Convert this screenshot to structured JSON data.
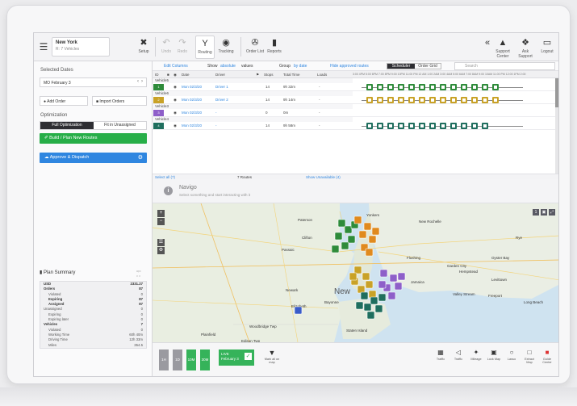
{
  "header": {
    "city": "New York",
    "city_sub": "R: 7 Vehicles",
    "setup_label": "Setup",
    "undo_label": "Undo",
    "redo_label": "Redo",
    "routing_label": "Routing",
    "tracking_label": "Tracking",
    "order_list_label": "Order List",
    "reports_label": "Reports",
    "support_center_label": "Support Center",
    "ask_support_label": "Ask Support",
    "logout_label": "Logout"
  },
  "left": {
    "selected_dates_label": "Selected Dates",
    "date_value": "MO February 3",
    "add_order": "Add Order",
    "import_orders": "Import Orders",
    "optimization_label": "Optimization",
    "tab_full": "Full Optimization",
    "tab_fit": "Fit in Unassigned",
    "build_btn": "Build / Plan New Routes",
    "approve_btn": "Approve & Dispatch",
    "plan_summary_title": "Plan Summary",
    "plan_summary_sub": "ᵃᵖᵒ ᵒ ᵒ",
    "summary_rows": [
      {
        "label": "USD",
        "value": "2331.27",
        "bold": true,
        "indent": false
      },
      {
        "label": "Orders",
        "value": "87",
        "bold": true,
        "indent": false
      },
      {
        "label": "Violated",
        "value": "0",
        "bold": false,
        "indent": true
      },
      {
        "label": "Expiring",
        "value": "87",
        "bold": true,
        "indent": true
      },
      {
        "label": "Assigned",
        "value": "87",
        "bold": true,
        "indent": true
      },
      {
        "label": "Unassigned",
        "value": "0",
        "bold": false,
        "indent": false
      },
      {
        "label": "Expiring",
        "value": "0",
        "bold": false,
        "indent": true
      },
      {
        "label": "Expiring later",
        "value": "0",
        "bold": false,
        "indent": true
      },
      {
        "label": "Vehicles",
        "value": "7",
        "bold": true,
        "indent": false
      },
      {
        "label": "Violated",
        "value": "0",
        "bold": false,
        "indent": true
      },
      {
        "label": "Working Time",
        "value": "60h 40m",
        "bold": false,
        "indent": true
      },
      {
        "label": "Driving Time",
        "value": "12h 33m",
        "bold": false,
        "indent": true
      },
      {
        "label": "Miles",
        "value": "354.5",
        "bold": false,
        "indent": true
      }
    ]
  },
  "toolbar": {
    "edit_columns": "Edit Columns",
    "show_label": "Show",
    "show_value": "absolute",
    "values_label": "values",
    "group_label": "Group",
    "group_value": "by date",
    "hide_approved": "Hide approved routes",
    "scheduler": "Scheduler",
    "order_grid": "Order Grid",
    "search_placeholder": "Search"
  },
  "table_header": {
    "id": "ID",
    "date": "Date",
    "driver": "Driver",
    "stops": "Stops",
    "total_time": "Total Time",
    "loads": "Loads",
    "timescale": "3:00 4PM 5:00 6PM 7:00 8PM 9:00 10PM 11:00 PM 12 AM 1:00 2AM 3:00 4AM 5:00 6AM 7:00 8AM 9:00 10AM 11:00 PM 12:00 1PM 2:00"
  },
  "routes": [
    {
      "group": "Vehicle5",
      "id": "1",
      "color": "#2e8b3a",
      "date": "Mon 02/3/20",
      "driver": "Driver 1",
      "stops": "14",
      "time": "9h 32m",
      "loads": "-",
      "stop_colors": [
        "#2e8b3a",
        "#2e8b3a",
        "#2e8b3a",
        "#2e8b3a",
        "#2e8b3a",
        "#2e8b3a",
        "#2e8b3a",
        "#2e8b3a",
        "#2e8b3a",
        "#2e8b3a",
        "#2e8b3a",
        "#2e8b3a",
        "#2e8b3a"
      ]
    },
    {
      "group": "Vehicle6",
      "id": "2",
      "color": "#c9a227",
      "date": "Mon 02/3/20",
      "driver": "Driver 2",
      "stops": "14",
      "time": "9h 14m",
      "loads": "-",
      "stop_colors": [
        "#c9a227",
        "#c9a227",
        "#c9a227",
        "#c9a227",
        "#c9a227",
        "#c9a227",
        "#c9a227",
        "#c9a227",
        "#c9a227",
        "#c9a227",
        "#c9a227",
        "#c9a227",
        "#c9a227"
      ]
    },
    {
      "group": "Vehicle3",
      "id": "3",
      "color": "#8e5fc9",
      "date": "Mon 02/3/20",
      "driver": "-",
      "stops": "0",
      "time": "0m",
      "loads": "-",
      "stop_colors": []
    },
    {
      "group": "Vehicle4",
      "id": "4",
      "color": "#1f6e5e",
      "date": "Mon 02/3/20",
      "driver": "-",
      "stops": "14",
      "time": "9h 58m",
      "loads": "-",
      "stop_colors": [
        "#1f6e5e",
        "#1f6e5e",
        "#1f6e5e",
        "#1f6e5e",
        "#1f6e5e",
        "#1f6e5e",
        "#1f6e5e",
        "#1f6e5e",
        "#1f6e5e",
        "#1f6e5e",
        "#1f6e5e",
        "#1f6e5e"
      ]
    }
  ],
  "table_footer": {
    "select_all": "Select all (7)",
    "routes_count": "7 Routes",
    "show_unavailable": "Show Unavailable (4)"
  },
  "navigo": {
    "title": "Navigo",
    "subtitle": "Select something and start interacting with it"
  },
  "map": {
    "labels": [
      "Paterson",
      "Yonkers",
      "New Rochelle",
      "Clifton",
      "Passaic",
      "Newark",
      "Elizabeth",
      "Bayonne",
      "Flushing",
      "Hempstead",
      "Jamaica",
      "Valley Stream",
      "Freeport",
      "Long Beach",
      "Rye",
      "Staten Island",
      "Woodbridge Twp",
      "Edison Twp",
      "Levittown",
      "Oyster Bay",
      "Garden City",
      "Plainfield"
    ],
    "big_label": "New"
  },
  "bottom": {
    "zoom_buttons": [
      "1H",
      "1D",
      "10M",
      "30M"
    ],
    "live_label": "LIVE",
    "live_date": "February 3",
    "pin_label": "Mark all on map",
    "tools": [
      "Traffic",
      "Traffic",
      "Mileage",
      "Lock Map",
      "Lasso",
      "Extract Map",
      "Guide Center"
    ]
  },
  "colors": {
    "green": "#27ae48",
    "blue": "#2f86e0",
    "dark": "#2e2e33"
  }
}
